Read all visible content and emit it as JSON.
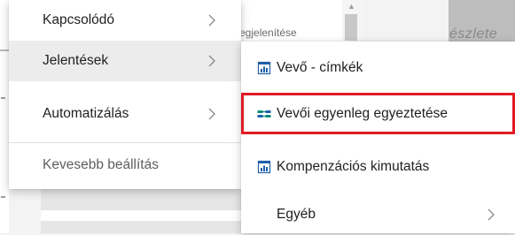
{
  "background": {
    "header_fragment": "egjelenítése",
    "right_fragment": "észlete"
  },
  "menu": {
    "items": [
      {
        "label": "Kapcsolódó",
        "has_submenu": true,
        "active": false
      },
      {
        "label": "Jelentések",
        "has_submenu": true,
        "active": true
      },
      {
        "label": "Automatizálás",
        "has_submenu": true,
        "active": false
      }
    ],
    "less_options_label": "Kevesebb beállítás"
  },
  "submenu": {
    "items": [
      {
        "label": "Vevő - címkék",
        "icon": "report-icon"
      },
      {
        "label": "Vevői egyenleg egyeztetése",
        "icon": "reconcile-icon",
        "highlighted": true
      },
      {
        "label": "Kompenzációs kimutatás",
        "icon": "report-icon"
      },
      {
        "label": "Egyéb",
        "has_submenu": true
      }
    ]
  },
  "colors": {
    "highlight_border": "#e01b24",
    "icon_blue": "#1f5fa8",
    "icon_teal": "#0f8a7a"
  }
}
